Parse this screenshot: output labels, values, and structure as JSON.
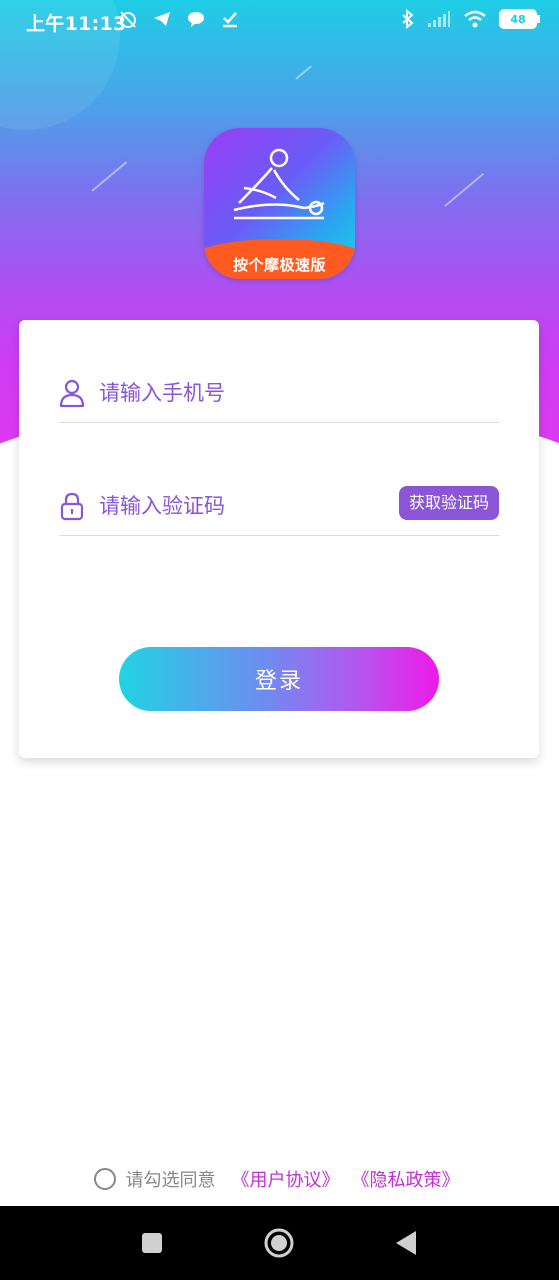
{
  "status_bar": {
    "time": "上午11:13",
    "left_icons": [
      "alarm-off-icon",
      "telegram-icon",
      "chat-icon",
      "download-done-icon"
    ],
    "right_icons": [
      "bluetooth-icon",
      "signal-icon",
      "wifi-icon"
    ],
    "battery": "48"
  },
  "logo": {
    "app_name": "按个摩极速版"
  },
  "form": {
    "phone_placeholder": "请输入手机号",
    "code_placeholder": "请输入验证码",
    "get_code_label": "获取验证码",
    "login_label": "登录"
  },
  "agreement": {
    "text": "请勾选同意",
    "user_agreement": "《用户协议》",
    "privacy_policy": "《隐私政策》"
  },
  "colors": {
    "accent": "#8a55d6",
    "link": "#c22fd6",
    "gradient_start": "#21d3e3",
    "gradient_end": "#ee1ae8"
  }
}
